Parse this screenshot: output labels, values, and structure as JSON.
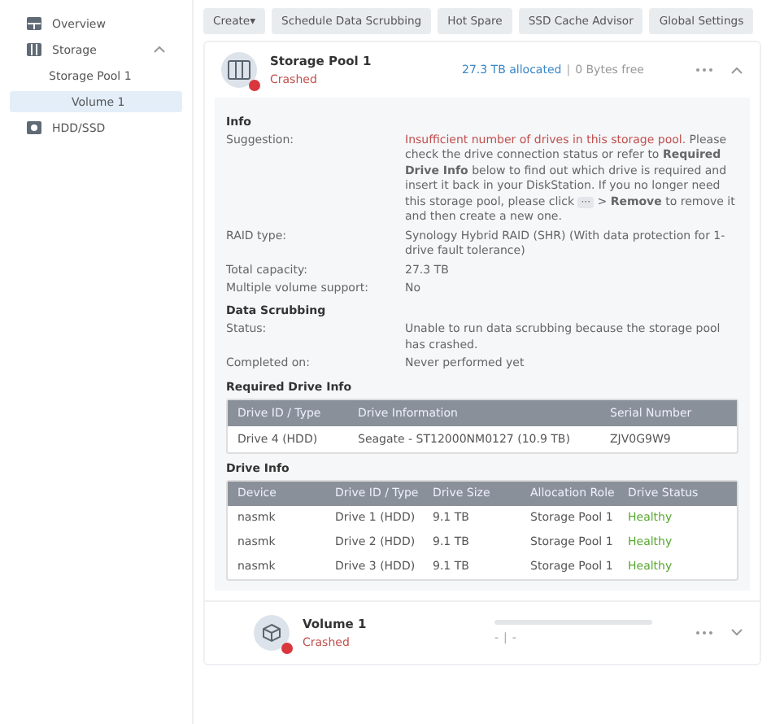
{
  "sidebar": {
    "items": [
      {
        "label": "Overview",
        "selected": false
      },
      {
        "label": "Storage",
        "selected": false,
        "expanded": true,
        "children": [
          {
            "label": "Storage Pool 1",
            "selected": false,
            "children": [
              {
                "label": "Volume 1",
                "selected": true
              }
            ]
          }
        ]
      },
      {
        "label": "HDD/SSD",
        "selected": false
      }
    ]
  },
  "toolbar": {
    "buttons": [
      {
        "label": "Create",
        "caret": "▾"
      },
      {
        "label": "Schedule Data Scrubbing"
      },
      {
        "label": "Hot Spare"
      },
      {
        "label": "SSD Cache Advisor"
      },
      {
        "label": "Global Settings"
      }
    ]
  },
  "pool": {
    "name": "Storage Pool 1",
    "status": "Crashed",
    "allocated": "27.3 TB allocated",
    "separator": "|",
    "free": "0 Bytes free",
    "expanded": true,
    "info": {
      "title": "Info",
      "suggestion_label": "Suggestion:",
      "suggestion_alert": "Insufficient number of drives in this storage pool.",
      "suggestion_before": " Please check the drive connection status or refer to **Required Drive Info** below to find out which drive is required and insert it back in your DiskStation. If you no longer need this storage pool, please click ",
      "suggestion_glyph": "···",
      "suggestion_after": " > **Remove** to remove it and then create a new one.",
      "rows": [
        {
          "label": "RAID type:",
          "value": "Synology Hybrid RAID (SHR) (With data protection for 1-drive fault tolerance)"
        },
        {
          "label": "Total capacity:",
          "value": "27.3 TB"
        },
        {
          "label": "Multiple volume support:",
          "value": "No"
        }
      ]
    },
    "scrubbing": {
      "title": "Data Scrubbing",
      "rows": [
        {
          "label": "Status:",
          "value": "Unable to run data scrubbing because the storage pool has crashed."
        },
        {
          "label": "Completed on:",
          "value": "Never performed yet"
        }
      ]
    },
    "required": {
      "title": "Required Drive Info",
      "columns": [
        "Drive ID / Type",
        "Drive Information",
        "Serial Number"
      ],
      "rows": [
        [
          "Drive 4 (HDD)",
          "Seagate - ST12000NM0127 (10.9 TB)",
          "ZJV0G9W9"
        ]
      ]
    },
    "drives": {
      "title": "Drive Info",
      "columns": [
        "Device",
        "Drive ID / Type",
        "Drive Size",
        "Allocation Role",
        "Drive Status"
      ],
      "rows": [
        [
          "nasmk",
          "Drive 1 (HDD)",
          "9.1 TB",
          "Storage Pool 1",
          "Healthy"
        ],
        [
          "nasmk",
          "Drive 2 (HDD)",
          "9.1 TB",
          "Storage Pool 1",
          "Healthy"
        ],
        [
          "nasmk",
          "Drive 3 (HDD)",
          "9.1 TB",
          "Storage Pool 1",
          "Healthy"
        ]
      ]
    }
  },
  "volume": {
    "name": "Volume 1",
    "status": "Crashed",
    "used": "-",
    "separator": "|",
    "total": "-",
    "expanded": false
  }
}
